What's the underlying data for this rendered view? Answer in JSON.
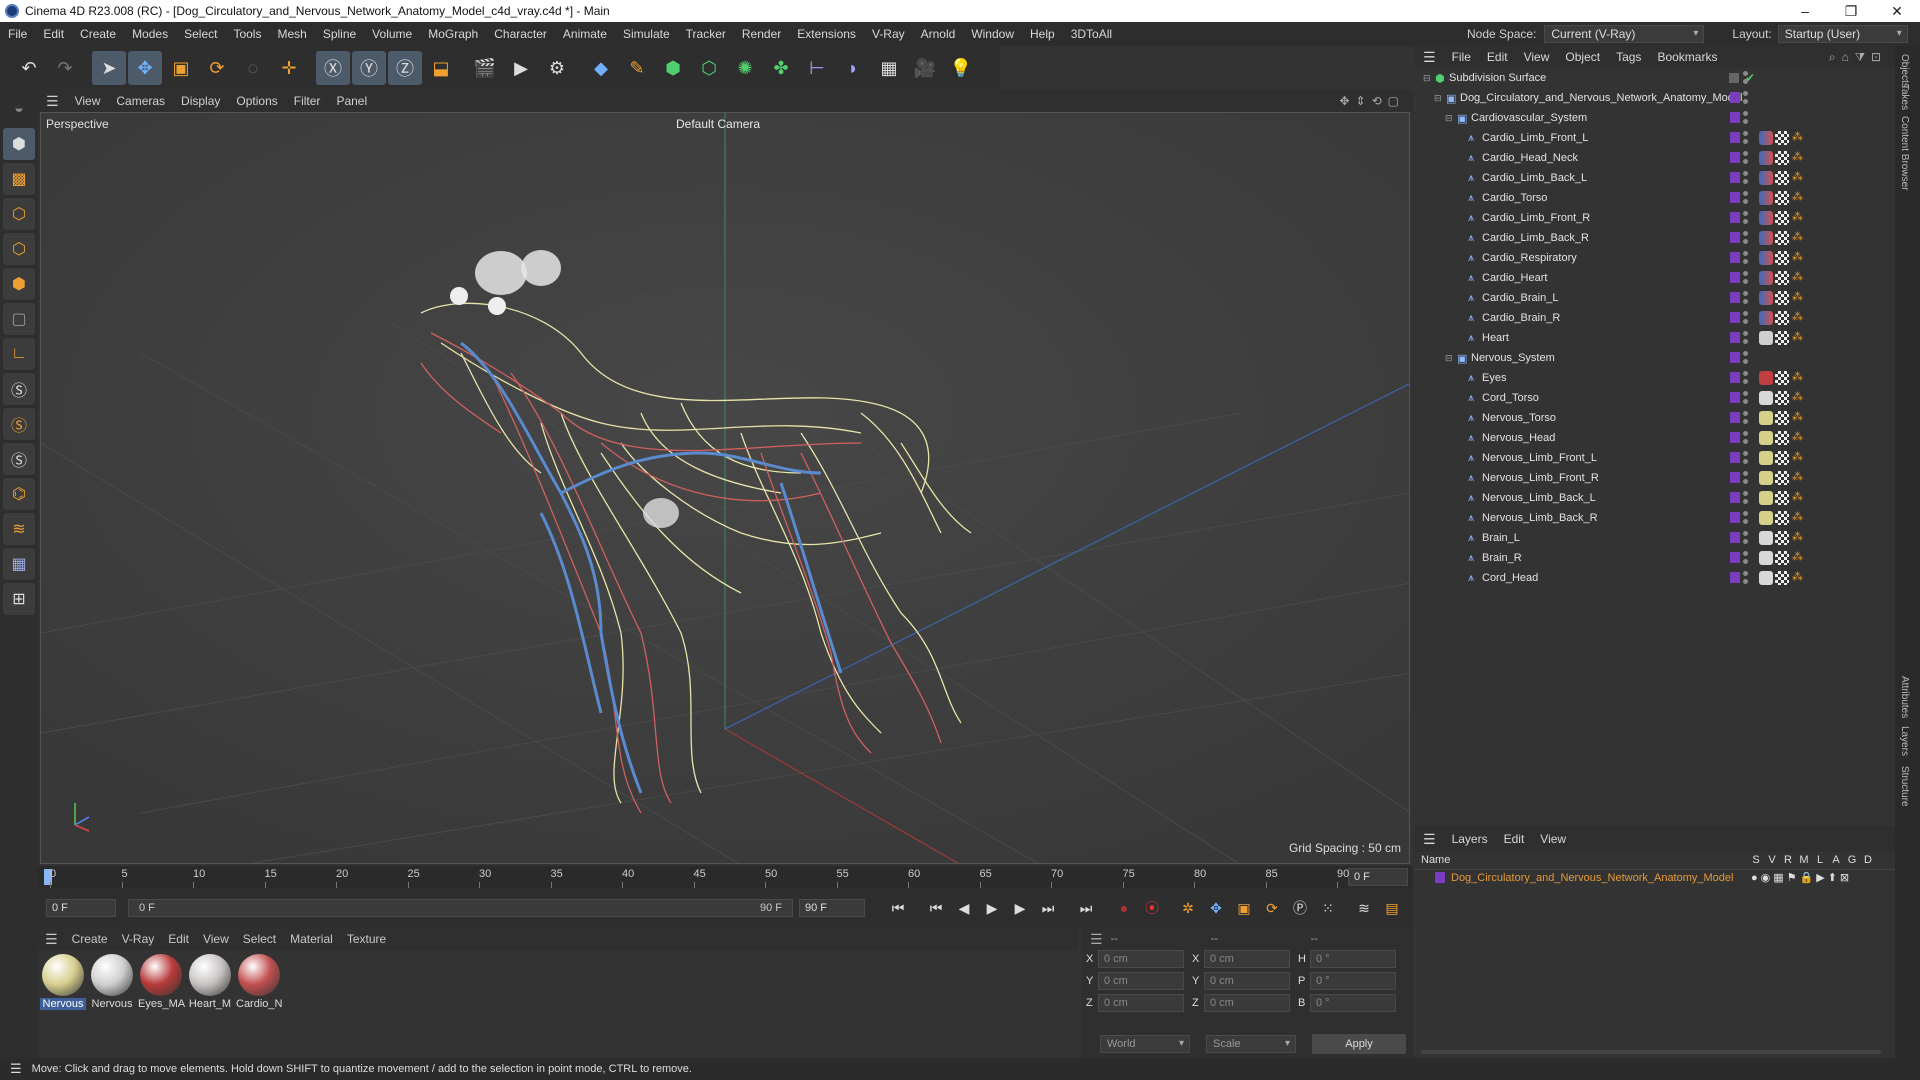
{
  "window": {
    "title": "Cinema 4D R23.008 (RC) - [Dog_Circulatory_and_Nervous_Network_Anatomy_Model_c4d_vray.c4d *] - Main",
    "min": "–",
    "max": "❐",
    "close": "✕"
  },
  "menubar": [
    "File",
    "Edit",
    "Create",
    "Modes",
    "Select",
    "Tools",
    "Mesh",
    "Spline",
    "Volume",
    "MoGraph",
    "Character",
    "Animate",
    "Simulate",
    "Tracker",
    "Render",
    "Extensions",
    "V-Ray",
    "Arnold",
    "Window",
    "Help",
    "3DToAll"
  ],
  "nodespace": {
    "label": "Node Space:",
    "value": "Current (V-Ray)",
    "layout_label": "Layout:",
    "layout_value": "Startup (User)"
  },
  "viewport": {
    "menu": [
      "View",
      "Cameras",
      "Display",
      "Options",
      "Filter",
      "Panel"
    ],
    "name": "Perspective",
    "camera": "Default Camera",
    "grid": "Grid Spacing : 50 cm"
  },
  "timeline": {
    "ticks": [
      "0",
      "5",
      "10",
      "15",
      "20",
      "25",
      "30",
      "35",
      "40",
      "45",
      "50",
      "55",
      "60",
      "65",
      "70",
      "75",
      "80",
      "85",
      "90"
    ],
    "frame": "0 F",
    "start": "0 F",
    "range_start": "0 F",
    "range_end": "90 F",
    "end": "90 F"
  },
  "materials": {
    "menu": [
      "Create",
      "V-Ray",
      "Edit",
      "View",
      "Select",
      "Material",
      "Texture"
    ],
    "items": [
      {
        "name": "Nervous",
        "color": "#d8cf8f"
      },
      {
        "name": "Nervous",
        "color": "#cfcfcf"
      },
      {
        "name": "Eyes_MA",
        "color": "#b83a3a"
      },
      {
        "name": "Heart_M",
        "color": "#c9c4c4"
      },
      {
        "name": "Cardio_N",
        "color": "#c25050"
      }
    ]
  },
  "coords": {
    "header": [
      "--",
      "--",
      "--"
    ],
    "rows": [
      [
        "X",
        "0 cm",
        "X",
        "0 cm",
        "H",
        "0 °"
      ],
      [
        "Y",
        "0 cm",
        "Y",
        "0 cm",
        "P",
        "0 °"
      ],
      [
        "Z",
        "0 cm",
        "Z",
        "0 cm",
        "B",
        "0 °"
      ]
    ],
    "world": "World",
    "scale": "Scale",
    "apply": "Apply"
  },
  "status": "Move: Click and drag to move elements. Hold down SHIFT to quantize movement / add to the selection in point mode, CTRL to remove.",
  "objects": {
    "menu": [
      "File",
      "Edit",
      "View",
      "Object",
      "Tags",
      "Bookmarks"
    ],
    "rows": [
      {
        "name": "Subdivision Surface",
        "indent": 0,
        "kind": "sds"
      },
      {
        "name": "Dog_Circulatory_and_Nervous_Network_Anatomy_Model",
        "indent": 1,
        "kind": "null"
      },
      {
        "name": "Cardiovascular_System",
        "indent": 2,
        "kind": "null"
      },
      {
        "name": "Cardio_Limb_Front_L",
        "indent": 3,
        "kind": "cardio"
      },
      {
        "name": "Cardio_Head_Neck",
        "indent": 3,
        "kind": "cardio"
      },
      {
        "name": "Cardio_Limb_Back_L",
        "indent": 3,
        "kind": "cardio"
      },
      {
        "name": "Cardio_Torso",
        "indent": 3,
        "kind": "cardio"
      },
      {
        "name": "Cardio_Limb_Front_R",
        "indent": 3,
        "kind": "cardio"
      },
      {
        "name": "Cardio_Limb_Back_R",
        "indent": 3,
        "kind": "cardio"
      },
      {
        "name": "Cardio_Respiratory",
        "indent": 3,
        "kind": "cardio"
      },
      {
        "name": "Cardio_Heart",
        "indent": 3,
        "kind": "cardio"
      },
      {
        "name": "Cardio_Brain_L",
        "indent": 3,
        "kind": "cardio"
      },
      {
        "name": "Cardio_Brain_R",
        "indent": 3,
        "kind": "cardio"
      },
      {
        "name": "Heart",
        "indent": 3,
        "kind": "heart"
      },
      {
        "name": "Nervous_System",
        "indent": 2,
        "kind": "null"
      },
      {
        "name": "Eyes",
        "indent": 3,
        "kind": "eyes"
      },
      {
        "name": "Cord_Torso",
        "indent": 3,
        "kind": "white"
      },
      {
        "name": "Nervous_Torso",
        "indent": 3,
        "kind": "nerv"
      },
      {
        "name": "Nervous_Head",
        "indent": 3,
        "kind": "nerv"
      },
      {
        "name": "Nervous_Limb_Front_L",
        "indent": 3,
        "kind": "nerv"
      },
      {
        "name": "Nervous_Limb_Front_R",
        "indent": 3,
        "kind": "nerv"
      },
      {
        "name": "Nervous_Limb_Back_L",
        "indent": 3,
        "kind": "nerv"
      },
      {
        "name": "Nervous_Limb_Back_R",
        "indent": 3,
        "kind": "nerv"
      },
      {
        "name": "Brain_L",
        "indent": 3,
        "kind": "white"
      },
      {
        "name": "Brain_R",
        "indent": 3,
        "kind": "white"
      },
      {
        "name": "Cord_Head",
        "indent": 3,
        "kind": "white"
      }
    ]
  },
  "layers": {
    "menu": [
      "Layers",
      "Edit",
      "View"
    ],
    "name_header": "Name",
    "flags": [
      "S",
      "V",
      "R",
      "M",
      "L",
      "A",
      "G",
      "D"
    ],
    "row": "Dog_Circulatory_and_Nervous_Network_Anatomy_Model"
  },
  "right_tabs": [
    "Objects",
    "Takes",
    "Content Browser",
    "Attributes",
    "Layers",
    "Structure"
  ]
}
